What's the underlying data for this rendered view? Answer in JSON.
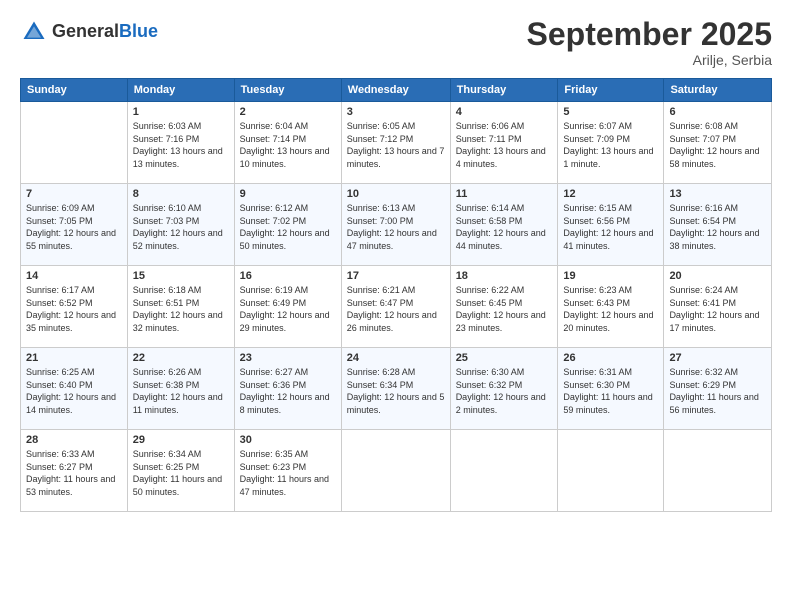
{
  "header": {
    "logo_line1": "General",
    "logo_line2": "Blue",
    "month_title": "September 2025",
    "location": "Arilje, Serbia"
  },
  "weekdays": [
    "Sunday",
    "Monday",
    "Tuesday",
    "Wednesday",
    "Thursday",
    "Friday",
    "Saturday"
  ],
  "weeks": [
    [
      {
        "day": "",
        "sunrise": "",
        "sunset": "",
        "daylight": ""
      },
      {
        "day": "1",
        "sunrise": "Sunrise: 6:03 AM",
        "sunset": "Sunset: 7:16 PM",
        "daylight": "Daylight: 13 hours and 13 minutes."
      },
      {
        "day": "2",
        "sunrise": "Sunrise: 6:04 AM",
        "sunset": "Sunset: 7:14 PM",
        "daylight": "Daylight: 13 hours and 10 minutes."
      },
      {
        "day": "3",
        "sunrise": "Sunrise: 6:05 AM",
        "sunset": "Sunset: 7:12 PM",
        "daylight": "Daylight: 13 hours and 7 minutes."
      },
      {
        "day": "4",
        "sunrise": "Sunrise: 6:06 AM",
        "sunset": "Sunset: 7:11 PM",
        "daylight": "Daylight: 13 hours and 4 minutes."
      },
      {
        "day": "5",
        "sunrise": "Sunrise: 6:07 AM",
        "sunset": "Sunset: 7:09 PM",
        "daylight": "Daylight: 13 hours and 1 minute."
      },
      {
        "day": "6",
        "sunrise": "Sunrise: 6:08 AM",
        "sunset": "Sunset: 7:07 PM",
        "daylight": "Daylight: 12 hours and 58 minutes."
      }
    ],
    [
      {
        "day": "7",
        "sunrise": "Sunrise: 6:09 AM",
        "sunset": "Sunset: 7:05 PM",
        "daylight": "Daylight: 12 hours and 55 minutes."
      },
      {
        "day": "8",
        "sunrise": "Sunrise: 6:10 AM",
        "sunset": "Sunset: 7:03 PM",
        "daylight": "Daylight: 12 hours and 52 minutes."
      },
      {
        "day": "9",
        "sunrise": "Sunrise: 6:12 AM",
        "sunset": "Sunset: 7:02 PM",
        "daylight": "Daylight: 12 hours and 50 minutes."
      },
      {
        "day": "10",
        "sunrise": "Sunrise: 6:13 AM",
        "sunset": "Sunset: 7:00 PM",
        "daylight": "Daylight: 12 hours and 47 minutes."
      },
      {
        "day": "11",
        "sunrise": "Sunrise: 6:14 AM",
        "sunset": "Sunset: 6:58 PM",
        "daylight": "Daylight: 12 hours and 44 minutes."
      },
      {
        "day": "12",
        "sunrise": "Sunrise: 6:15 AM",
        "sunset": "Sunset: 6:56 PM",
        "daylight": "Daylight: 12 hours and 41 minutes."
      },
      {
        "day": "13",
        "sunrise": "Sunrise: 6:16 AM",
        "sunset": "Sunset: 6:54 PM",
        "daylight": "Daylight: 12 hours and 38 minutes."
      }
    ],
    [
      {
        "day": "14",
        "sunrise": "Sunrise: 6:17 AM",
        "sunset": "Sunset: 6:52 PM",
        "daylight": "Daylight: 12 hours and 35 minutes."
      },
      {
        "day": "15",
        "sunrise": "Sunrise: 6:18 AM",
        "sunset": "Sunset: 6:51 PM",
        "daylight": "Daylight: 12 hours and 32 minutes."
      },
      {
        "day": "16",
        "sunrise": "Sunrise: 6:19 AM",
        "sunset": "Sunset: 6:49 PM",
        "daylight": "Daylight: 12 hours and 29 minutes."
      },
      {
        "day": "17",
        "sunrise": "Sunrise: 6:21 AM",
        "sunset": "Sunset: 6:47 PM",
        "daylight": "Daylight: 12 hours and 26 minutes."
      },
      {
        "day": "18",
        "sunrise": "Sunrise: 6:22 AM",
        "sunset": "Sunset: 6:45 PM",
        "daylight": "Daylight: 12 hours and 23 minutes."
      },
      {
        "day": "19",
        "sunrise": "Sunrise: 6:23 AM",
        "sunset": "Sunset: 6:43 PM",
        "daylight": "Daylight: 12 hours and 20 minutes."
      },
      {
        "day": "20",
        "sunrise": "Sunrise: 6:24 AM",
        "sunset": "Sunset: 6:41 PM",
        "daylight": "Daylight: 12 hours and 17 minutes."
      }
    ],
    [
      {
        "day": "21",
        "sunrise": "Sunrise: 6:25 AM",
        "sunset": "Sunset: 6:40 PM",
        "daylight": "Daylight: 12 hours and 14 minutes."
      },
      {
        "day": "22",
        "sunrise": "Sunrise: 6:26 AM",
        "sunset": "Sunset: 6:38 PM",
        "daylight": "Daylight: 12 hours and 11 minutes."
      },
      {
        "day": "23",
        "sunrise": "Sunrise: 6:27 AM",
        "sunset": "Sunset: 6:36 PM",
        "daylight": "Daylight: 12 hours and 8 minutes."
      },
      {
        "day": "24",
        "sunrise": "Sunrise: 6:28 AM",
        "sunset": "Sunset: 6:34 PM",
        "daylight": "Daylight: 12 hours and 5 minutes."
      },
      {
        "day": "25",
        "sunrise": "Sunrise: 6:30 AM",
        "sunset": "Sunset: 6:32 PM",
        "daylight": "Daylight: 12 hours and 2 minutes."
      },
      {
        "day": "26",
        "sunrise": "Sunrise: 6:31 AM",
        "sunset": "Sunset: 6:30 PM",
        "daylight": "Daylight: 11 hours and 59 minutes."
      },
      {
        "day": "27",
        "sunrise": "Sunrise: 6:32 AM",
        "sunset": "Sunset: 6:29 PM",
        "daylight": "Daylight: 11 hours and 56 minutes."
      }
    ],
    [
      {
        "day": "28",
        "sunrise": "Sunrise: 6:33 AM",
        "sunset": "Sunset: 6:27 PM",
        "daylight": "Daylight: 11 hours and 53 minutes."
      },
      {
        "day": "29",
        "sunrise": "Sunrise: 6:34 AM",
        "sunset": "Sunset: 6:25 PM",
        "daylight": "Daylight: 11 hours and 50 minutes."
      },
      {
        "day": "30",
        "sunrise": "Sunrise: 6:35 AM",
        "sunset": "Sunset: 6:23 PM",
        "daylight": "Daylight: 11 hours and 47 minutes."
      },
      {
        "day": "",
        "sunrise": "",
        "sunset": "",
        "daylight": ""
      },
      {
        "day": "",
        "sunrise": "",
        "sunset": "",
        "daylight": ""
      },
      {
        "day": "",
        "sunrise": "",
        "sunset": "",
        "daylight": ""
      },
      {
        "day": "",
        "sunrise": "",
        "sunset": "",
        "daylight": ""
      }
    ]
  ]
}
